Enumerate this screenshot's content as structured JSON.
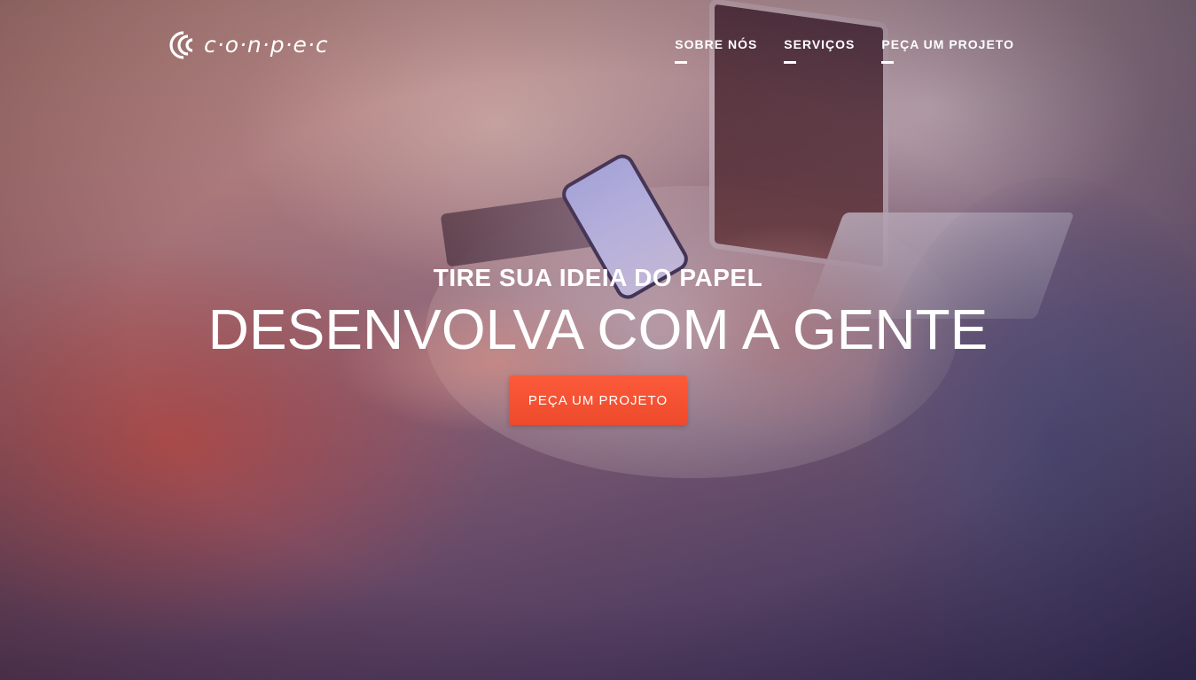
{
  "brand": {
    "logo_text": "c·o·n·p·e·c",
    "logo_icon": "conpec-logo-icon"
  },
  "nav": {
    "items": [
      {
        "label": "SOBRE NÓS"
      },
      {
        "label": "SERVIÇOS"
      },
      {
        "label": "PEÇA UM PROJETO"
      }
    ]
  },
  "hero": {
    "subtitle": "TIRE SUA IDEIA DO PAPEL",
    "title": "DESENVOLVA COM A GENTE",
    "cta_label": "PEÇA UM PROJETO",
    "background_image": "people-with-phone-and-laptop-photo"
  },
  "colors": {
    "accent": "#f4512f",
    "text": "#ffffff"
  }
}
